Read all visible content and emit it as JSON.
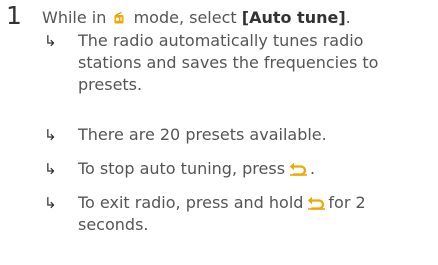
{
  "step": {
    "number": "1",
    "text_before_icon": "While in",
    "text_after_icon": "mode, select",
    "option_label": "[Auto tune]",
    "trailing_punct": ".",
    "mode_icon": "radio-mode-icon"
  },
  "results": [
    {
      "arrow": "↳",
      "lines": [
        "The radio automatically tunes radio",
        "stations and saves the frequencies to",
        "presets."
      ]
    },
    {
      "arrow": "↳",
      "text": "There are 20 presets available."
    },
    {
      "arrow": "↳",
      "text_before_icon": "To stop auto tuning, press",
      "text_after_icon": ".",
      "icon": "back-icon"
    },
    {
      "arrow": "↳",
      "text_before_icon": "To exit radio, press and hold",
      "text_after_icon_line1": "for 2",
      "text_line2": "seconds.",
      "icon": "back-icon"
    }
  ],
  "colors": {
    "text": "#555555",
    "heading": "#333333",
    "icon_accent": "#f0a800"
  }
}
